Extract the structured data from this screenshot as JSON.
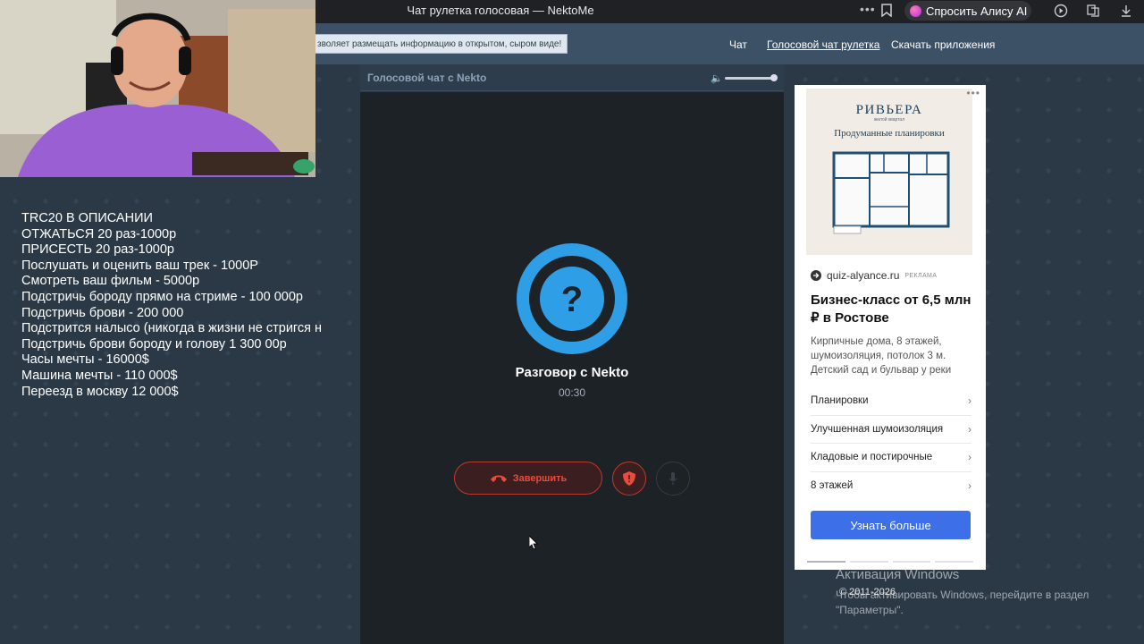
{
  "browser": {
    "title": "Чат рулетка голосовая — NektoMe",
    "menu_dots": "•••",
    "alice_label": "Спросить Алису AI"
  },
  "site": {
    "notice": "зволяет размещать информацию в открытом, сыром виде!",
    "nav": [
      {
        "label": "Чат"
      },
      {
        "label": "Голосовой чат рулетка"
      },
      {
        "label": "Скачать приложения"
      }
    ]
  },
  "overlay": {
    "lines": [
      "TRC20 В ОПИСАНИИ",
      "ОТЖАТЬСЯ 20 раз-1000р",
      "ПРИСЕСТЬ 20 раз-1000р",
      "Послушать и оценить ваш трек - 1000Р",
      "Смотреть ваш фильм - 5000р",
      "Подстричь бороду прямо на стриме - 100 000р",
      "Подстричь брови - 200 000",
      "Подстрится налысо (никогда в жизни не стригся н",
      "Подстричь брови бороду и голову 1 300 00р",
      "Часы мечты - 16000$",
      "Машина мечты - 110 000$",
      "Переезд в москву 12 000$"
    ]
  },
  "chat": {
    "header_title": "Голосовой чат с Nekto",
    "volume": 0.95,
    "avatar_glyph": "?",
    "caller": "Разговор с Nekto",
    "timer": "00:30",
    "end_label": "Завершить"
  },
  "ad": {
    "menu": "•••",
    "brand": "РИВЬЕРА",
    "brand_sub": "жилой квартал",
    "slogan": "Продуманные планировки",
    "domain": "quiz-alyance.ru",
    "tag": "РЕКЛАМА",
    "headline": "Бизнес-класс от 6,5 млн ₽ в Ростове",
    "description": "Кирпичные дома, 8 этажей, шумоизоляция, потолок 3 м. Детский сад и бульвар у реки",
    "links": [
      {
        "label": "Планировки"
      },
      {
        "label": "Улучшенная шумоизоляция"
      },
      {
        "label": "Кладовые и постирочные"
      },
      {
        "label": "8 этажей"
      }
    ],
    "cta": "Узнать больше"
  },
  "footer": {
    "copyright": "© 2011-2026"
  },
  "windows": {
    "heading": "Активация Windows",
    "text": "Чтобы активировать Windows, перейдите в раздел \"Параметры\"."
  },
  "colors": {
    "accent_blue": "#2e9ee6",
    "end_red": "#e74c3c",
    "ad_cta": "#3d6fe8"
  }
}
